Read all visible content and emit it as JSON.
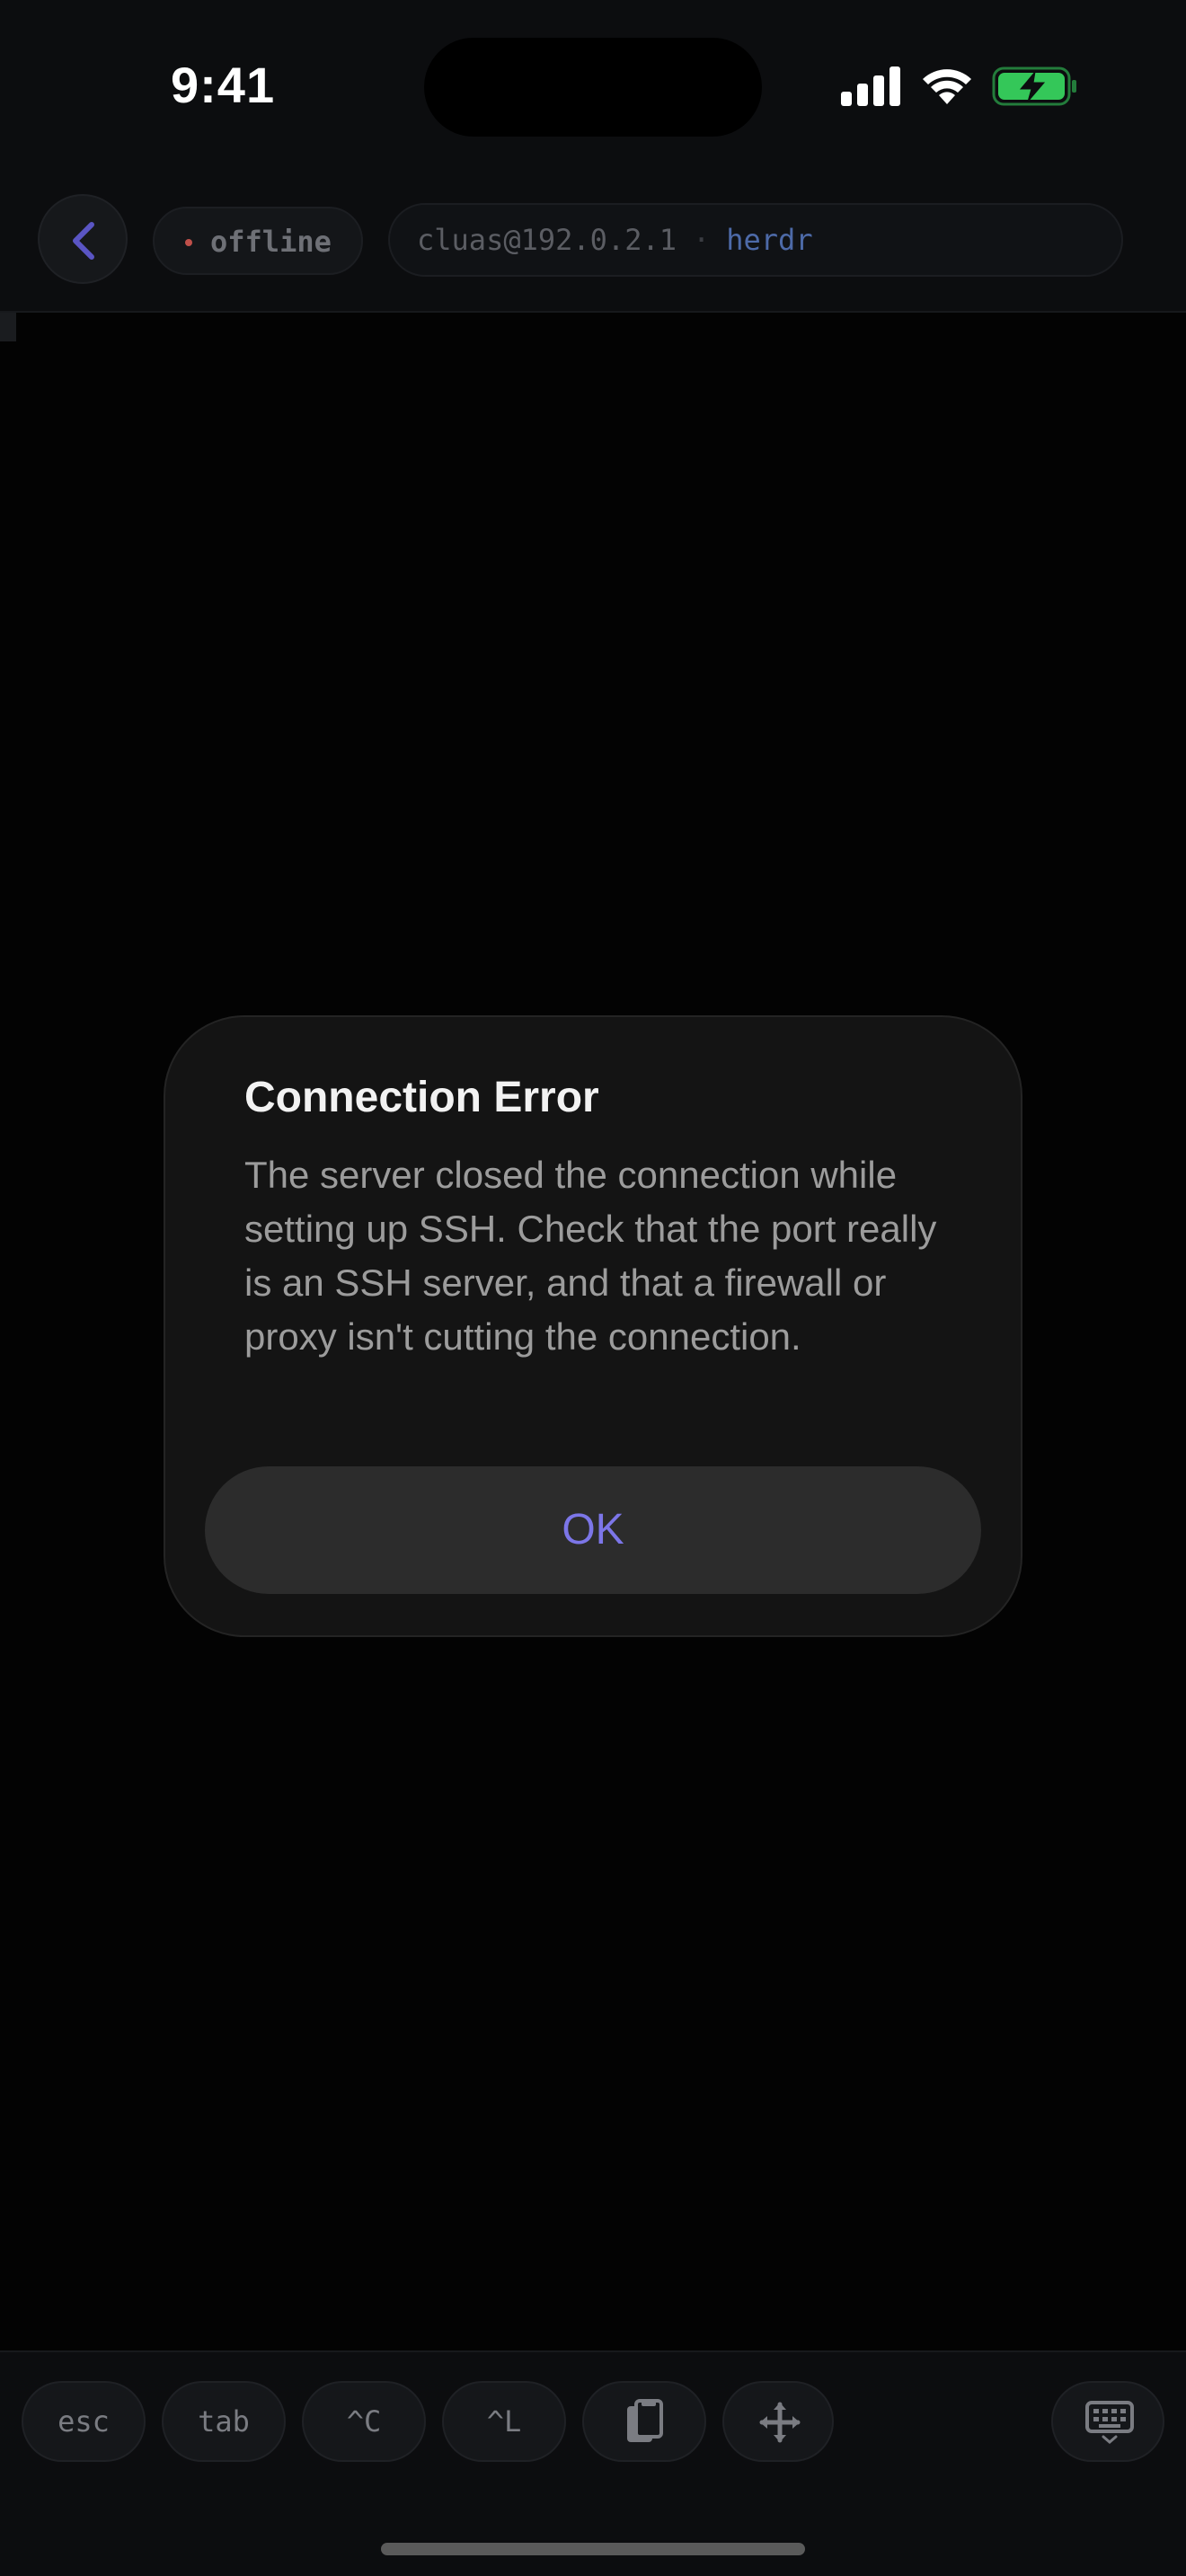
{
  "status_bar": {
    "time": "9:41"
  },
  "toolbar": {
    "connection_status": "offline",
    "host": "cluas@192.0.2.1",
    "separator": "·",
    "session": "herdr"
  },
  "dialog": {
    "title": "Connection Error",
    "message": "The server closed the connection while setting up SSH. Check that the port really is an SSH server, and that a firewall or proxy isn't cutting the connection.",
    "ok_label": "OK"
  },
  "keys": {
    "esc": "esc",
    "tab": "tab",
    "ctrl_c": "^C",
    "ctrl_l": "^L"
  },
  "colors": {
    "accent": "#7c76e8",
    "offline_dot": "#c0504a",
    "session": "#4d6aa8",
    "battery": "#34c759"
  },
  "icons": {
    "back": "chevron-left-icon",
    "paste": "clipboard-icon",
    "move": "move-arrows-icon",
    "keyboard": "keyboard-icon"
  }
}
